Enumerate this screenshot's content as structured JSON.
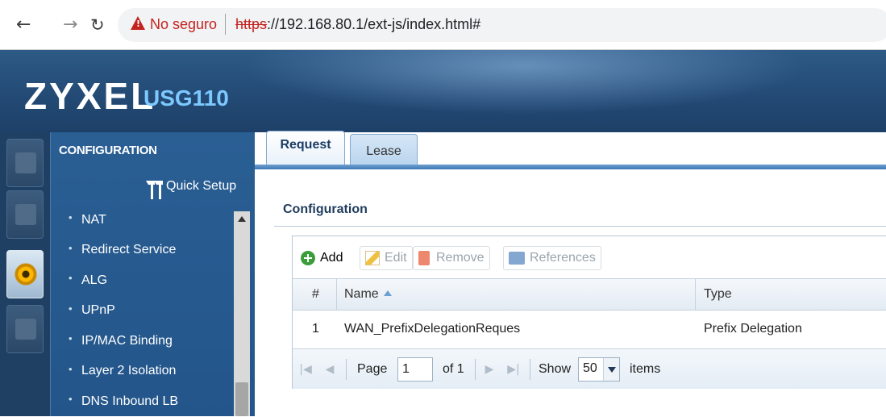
{
  "browser": {
    "security_text": "No seguro",
    "url_scheme": "https",
    "url_rest": "://192.168.80.1/ext-js/index.html#"
  },
  "header": {
    "brand": "ZYXEL",
    "model": "USG110"
  },
  "sidebar": {
    "title": "CONFIGURATION",
    "quick_setup": "Quick Setup",
    "items": [
      {
        "label": "NAT"
      },
      {
        "label": "Redirect Service"
      },
      {
        "label": "ALG"
      },
      {
        "label": "UPnP"
      },
      {
        "label": "IP/MAC Binding"
      },
      {
        "label": "Layer 2 Isolation"
      },
      {
        "label": "DNS Inbound LB"
      }
    ]
  },
  "tabs": [
    {
      "label": "Request",
      "active": true
    },
    {
      "label": "Lease",
      "active": false
    }
  ],
  "main": {
    "section_title": "Configuration",
    "toolbar": {
      "add": "Add",
      "edit": "Edit",
      "remove": "Remove",
      "references": "References"
    },
    "columns": [
      "#",
      "Name",
      "Type"
    ],
    "rows": [
      {
        "index": "1",
        "name": "WAN_PrefixDelegationReques",
        "type": "Prefix Delegation"
      }
    ],
    "pager": {
      "page_label": "Page",
      "page_value": "1",
      "of_text": "of 1",
      "show_label": "Show",
      "show_value": "50",
      "items_label": "items"
    }
  },
  "colors": {
    "header_blue": "#244c77",
    "sidebar_blue": "#23558a",
    "brand_accent": "#7cc8ff",
    "insecure_red": "#c5221f"
  }
}
